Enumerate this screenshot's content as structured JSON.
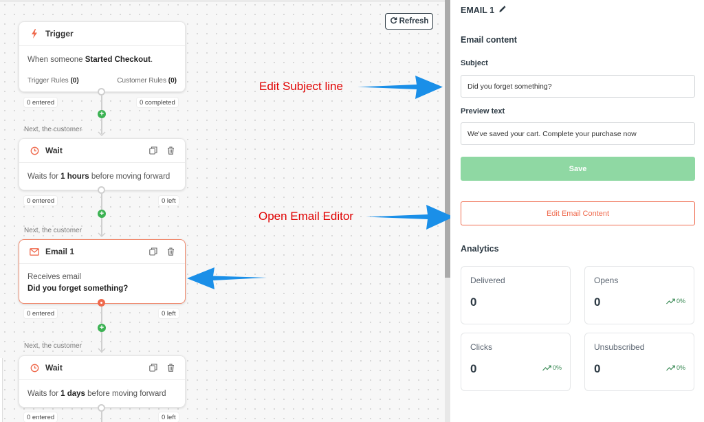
{
  "canvas": {
    "refresh_label": "Refresh",
    "next_label": "Next, the customer",
    "trigger": {
      "title": "Trigger",
      "desc_prefix": "When someone ",
      "desc_strong": "Started Checkout",
      "desc_suffix": ".",
      "trigger_rules_label": "Trigger Rules ",
      "trigger_rules_count": "(0)",
      "customer_rules_label": "Customer Rules ",
      "customer_rules_count": "(0)",
      "entered": "0 entered",
      "completed": "0 completed"
    },
    "wait1": {
      "title": "Wait",
      "desc_prefix": "Waits for ",
      "desc_strong": "1 hours",
      "desc_suffix": " before moving forward",
      "entered": "0 entered",
      "left": "0 left"
    },
    "email1": {
      "title": "Email 1",
      "line1": "Receives email",
      "line2": "Did you forget something?",
      "entered": "0 entered",
      "left": "0 left"
    },
    "wait2": {
      "title": "Wait",
      "desc_prefix": "Waits for ",
      "desc_strong": "1 days",
      "desc_suffix": " before moving forward",
      "entered": "0 entered",
      "left": "0 left"
    }
  },
  "annotations": {
    "subject": "Edit Subject line",
    "editor": "Open Email Editor"
  },
  "panel": {
    "title": "EMAIL 1",
    "email_content_title": "Email content",
    "subject_label": "Subject",
    "subject_value": "Did you forget something?",
    "preview_label": "Preview text",
    "preview_value": "We've saved your cart. Complete your purchase now",
    "save_label": "Save",
    "edit_label": "Edit Email Content",
    "analytics_title": "Analytics",
    "cards": [
      {
        "label": "Delivered",
        "value": "0",
        "trend": ""
      },
      {
        "label": "Opens",
        "value": "0",
        "trend": "0%"
      },
      {
        "label": "Clicks",
        "value": "0",
        "trend": "0%"
      },
      {
        "label": "Unsubscribed",
        "value": "0",
        "trend": "0%"
      }
    ]
  },
  "colors": {
    "accent": "#ef6a4d",
    "success": "#3cb253",
    "save_disabled": "#8fd8a3",
    "annotation": "#e00000",
    "arrow": "#1a8fe8"
  }
}
